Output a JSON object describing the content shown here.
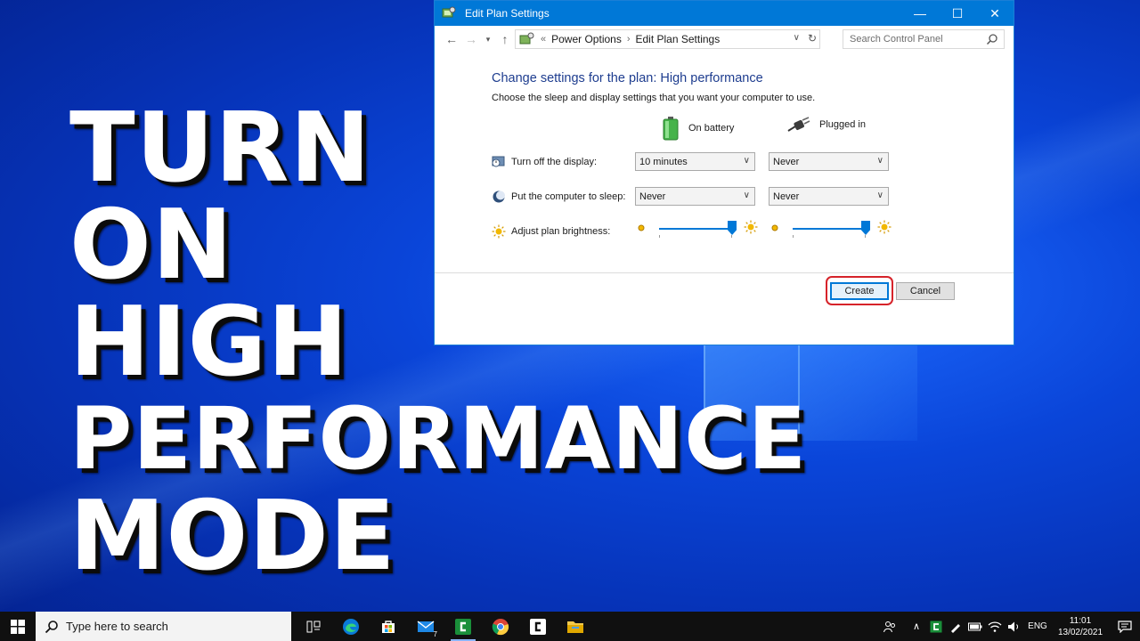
{
  "headline": {
    "lines": [
      "TURN",
      "ON",
      "HIGH",
      "PERFORMANCE",
      "MODE"
    ]
  },
  "window": {
    "title": "Edit Plan Settings",
    "controls": {
      "minimize": "—",
      "maximize": "☐",
      "close": "✕"
    }
  },
  "addressbar": {
    "overflow": "«",
    "crumbs": [
      "Power Options",
      "Edit Plan Settings"
    ],
    "search_placeholder": "Search Control Panel"
  },
  "content": {
    "heading": "Change settings for the plan: High performance",
    "subheading": "Choose the sleep and display settings that you want your computer to use.",
    "col_battery": "On battery",
    "col_plugged": "Plugged in",
    "rows": [
      {
        "label": "Turn off the display:",
        "battery": "10 minutes",
        "plugged": "Never"
      },
      {
        "label": "Put the computer to sleep:",
        "battery": "Never",
        "plugged": "Never"
      },
      {
        "label": "Adjust plan brightness:"
      }
    ],
    "brightness_battery": 1.0,
    "brightness_plugged": 1.0
  },
  "buttons": {
    "create": "Create",
    "cancel": "Cancel"
  },
  "taskbar": {
    "search_placeholder": "Type here to search",
    "mail_badge": "7",
    "language": "ENG",
    "time": "11:01",
    "date": "13/02/2021"
  },
  "colors": {
    "accent": "#0078d7",
    "highlight": "#d6232a",
    "heading": "#1e3d8f"
  }
}
